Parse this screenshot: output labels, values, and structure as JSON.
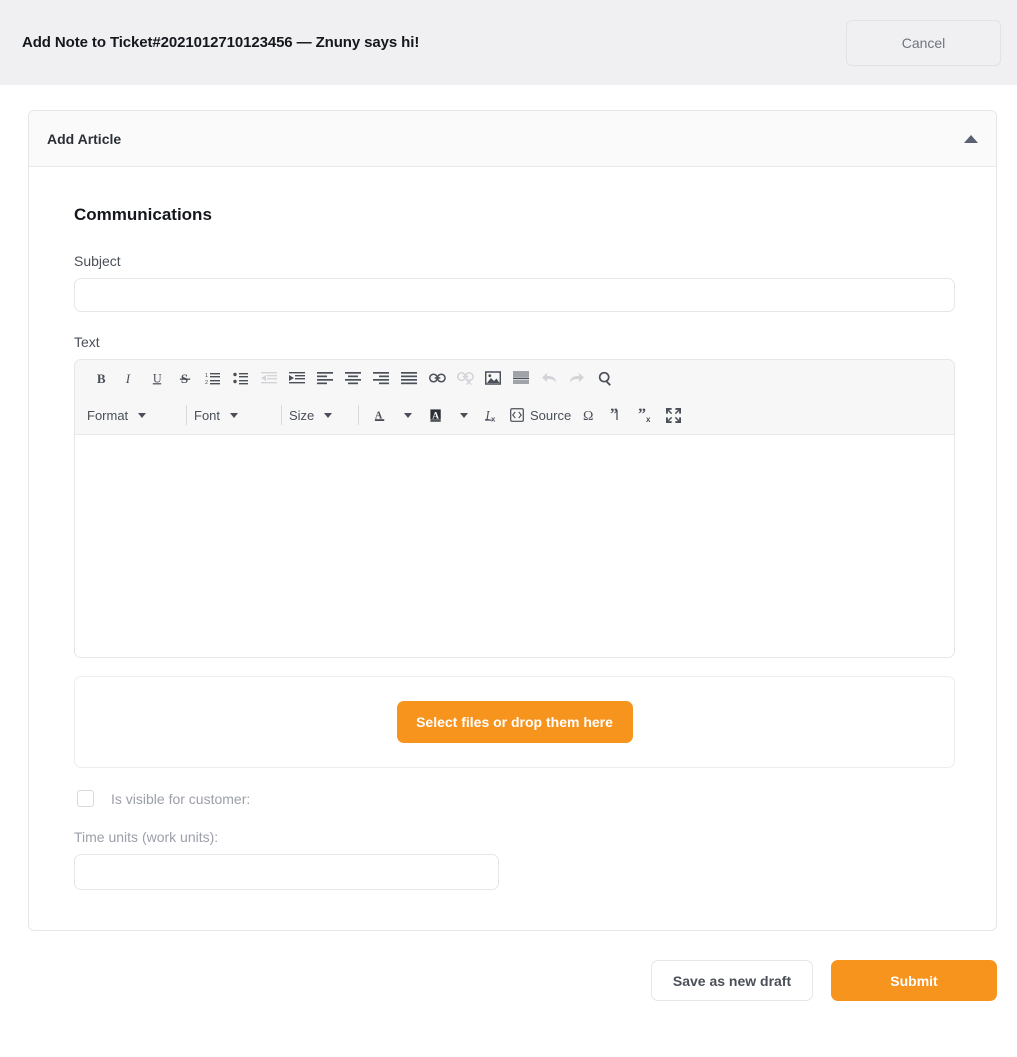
{
  "topbar": {
    "title": "Add Note to Ticket#2021012710123456 — Znuny says hi!",
    "cancel_label": "Cancel"
  },
  "panel": {
    "header_title": "Add Article",
    "collapse_icon": "triangle-up-icon"
  },
  "form": {
    "section_title": "Communications",
    "subject_label": "Subject",
    "subject_value": "",
    "subject_placeholder": "",
    "text_label": "Text",
    "body_value": "",
    "dropzone_button_label": "Select files or drop them here",
    "visible_for_customer_label": "Is visible for customer:",
    "visible_for_customer_checked": false,
    "time_units_label": "Time units (work units):",
    "time_units_value": "",
    "time_units_placeholder": ""
  },
  "editor_toolbar": {
    "row1": [
      {
        "name": "bold-icon",
        "title": "Bold",
        "disabled": false
      },
      {
        "name": "italic-icon",
        "title": "Italic",
        "disabled": false
      },
      {
        "name": "underline-icon",
        "title": "Underline",
        "disabled": false
      },
      {
        "name": "strikethrough-icon",
        "title": "Strike Through",
        "disabled": false
      },
      {
        "name": "numbered-list-icon",
        "title": "Insert/Remove Numbered List",
        "disabled": false
      },
      {
        "name": "bulleted-list-icon",
        "title": "Insert/Remove Bulleted List",
        "disabled": false
      },
      {
        "name": "outdent-icon",
        "title": "Decrease Indent",
        "disabled": true
      },
      {
        "name": "indent-icon",
        "title": "Increase Indent",
        "disabled": false
      },
      {
        "name": "align-left-icon",
        "title": "Align Left",
        "disabled": false
      },
      {
        "name": "align-center-icon",
        "title": "Center",
        "disabled": false
      },
      {
        "name": "align-right-icon",
        "title": "Align Right",
        "disabled": false
      },
      {
        "name": "align-justify-icon",
        "title": "Justify",
        "disabled": false
      },
      {
        "name": "link-icon",
        "title": "Link",
        "disabled": false
      },
      {
        "name": "unlink-icon",
        "title": "Unlink",
        "disabled": true
      },
      {
        "name": "image-icon",
        "title": "Image",
        "disabled": false
      },
      {
        "name": "horizontal-rule-icon",
        "title": "Insert Horizontal Line",
        "disabled": false
      },
      {
        "name": "undo-icon",
        "title": "Undo",
        "disabled": true
      },
      {
        "name": "redo-icon",
        "title": "Redo",
        "disabled": true
      },
      {
        "name": "search-icon",
        "title": "Find",
        "disabled": false
      }
    ],
    "format_label": "Format",
    "font_label": "Font",
    "size_label": "Size",
    "source_label": "Source",
    "row2_icons": [
      {
        "name": "text-color-icon",
        "title": "Text Color"
      },
      {
        "name": "background-color-icon",
        "title": "Background Color"
      },
      {
        "name": "remove-format-icon",
        "title": "Remove Format"
      },
      {
        "name": "source-icon",
        "title": "Source"
      },
      {
        "name": "special-character-icon",
        "title": "Insert Special Character"
      },
      {
        "name": "quote-open-icon",
        "title": "Insert Quote"
      },
      {
        "name": "quote-close-icon",
        "title": "Remove Quote"
      },
      {
        "name": "maximize-icon",
        "title": "Maximize"
      }
    ]
  },
  "footer": {
    "save_draft_label": "Save as new draft",
    "submit_label": "Submit"
  },
  "colors": {
    "accent_orange": "#f7941e",
    "header_band": "#f0f0f3",
    "panel_header": "#fafafa",
    "border": "#e6e6ea",
    "muted_text": "#9b9fa8"
  }
}
